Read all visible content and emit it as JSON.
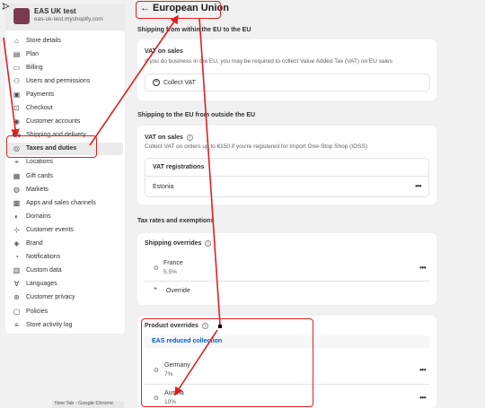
{
  "store": {
    "name": "EAS UK test",
    "url": "eas-uk-test.myshopify.com"
  },
  "sidebar": {
    "items": [
      {
        "label": "Store details",
        "icon": "store-icon"
      },
      {
        "label": "Plan",
        "icon": "plan-icon"
      },
      {
        "label": "Billing",
        "icon": "billing-icon"
      },
      {
        "label": "Users and permissions",
        "icon": "users-icon"
      },
      {
        "label": "Payments",
        "icon": "payments-icon"
      },
      {
        "label": "Checkout",
        "icon": "checkout-icon"
      },
      {
        "label": "Customer accounts",
        "icon": "customer-accounts-icon"
      },
      {
        "label": "Shipping and delivery",
        "icon": "shipping-icon"
      },
      {
        "label": "Taxes and duties",
        "icon": "taxes-icon",
        "active": true
      },
      {
        "label": "Locations",
        "icon": "locations-icon"
      },
      {
        "label": "Gift cards",
        "icon": "gift-card-icon"
      },
      {
        "label": "Markets",
        "icon": "markets-icon"
      },
      {
        "label": "Apps and sales channels",
        "icon": "apps-icon"
      },
      {
        "label": "Domains",
        "icon": "domains-icon"
      },
      {
        "label": "Customer events",
        "icon": "customer-events-icon"
      },
      {
        "label": "Brand",
        "icon": "brand-icon"
      },
      {
        "label": "Notifications",
        "icon": "notifications-icon"
      },
      {
        "label": "Custom data",
        "icon": "custom-data-icon"
      },
      {
        "label": "Languages",
        "icon": "languages-icon"
      },
      {
        "label": "Customer privacy",
        "icon": "privacy-icon"
      },
      {
        "label": "Policies",
        "icon": "policies-icon"
      },
      {
        "label": "Store activity log",
        "icon": "activity-log-icon"
      }
    ]
  },
  "page": {
    "title": "European Union"
  },
  "within_eu": {
    "heading": "Shipping from within the EU to the EU",
    "card_title": "VAT on sales",
    "card_text": "If you do business in the EU, you may be required to collect Value Added Tax (VAT) on EU sales",
    "button_label": "Collect VAT"
  },
  "outside_eu": {
    "heading": "Shipping to the EU from outside the EU",
    "card_title": "VAT on sales",
    "card_text": "Collect VAT on orders up to €150 if you're registered for Import One-Stop Shop (IOSS)",
    "registrations_title": "VAT registrations",
    "registration_country": "Estonia"
  },
  "rates": {
    "heading": "Tax rates and exemptions",
    "shipping_overrides": {
      "title": "Shipping overrides",
      "country": "France",
      "rate": "5.5%",
      "add_label": "Override"
    },
    "product_overrides": {
      "title": "Product overrides",
      "collection": "EAS reduced collection",
      "rows": [
        {
          "country": "Germany",
          "rate": "7%"
        },
        {
          "country": "Austria",
          "rate": "10%"
        }
      ]
    }
  },
  "taskbar": {
    "label": "New Tab - Google Chrome"
  },
  "colors": {
    "annotation": "#e02020",
    "link": "#005bd3",
    "store_avatar": "#7a3c4d"
  }
}
